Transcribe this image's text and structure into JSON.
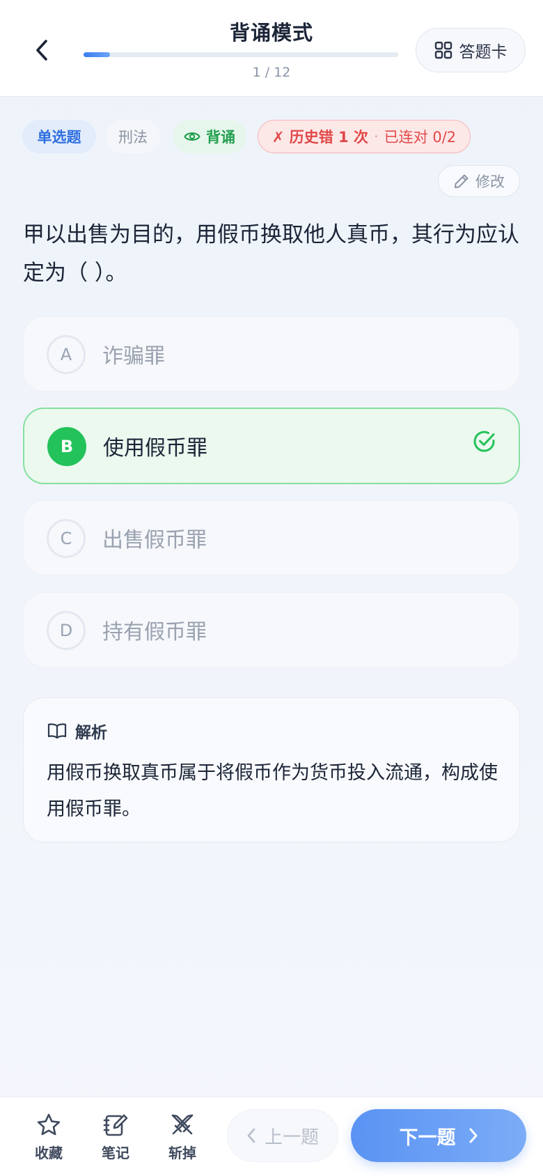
{
  "header": {
    "title": "背诵模式",
    "progress_text": "1 / 12",
    "progress_fraction": 0.083,
    "answer_card_label": "答题卡"
  },
  "tags": {
    "question_type": "单选题",
    "subject": "刑法",
    "mode": "背诵",
    "history_wrong": "✗ 历史错 1 次",
    "separator": "·",
    "streak": "已连对 0/2"
  },
  "edit_label": "修改",
  "question": "甲以出售为目的，用假币换取他人真币，其行为应认定为（ ）。",
  "options": [
    {
      "letter": "A",
      "text": "诈骗罪"
    },
    {
      "letter": "B",
      "text": "使用假币罪"
    },
    {
      "letter": "C",
      "text": "出售假币罪"
    },
    {
      "letter": "D",
      "text": "持有假币罪"
    }
  ],
  "selected_option": "B",
  "analysis": {
    "title": "解析",
    "body": "用假币换取真币属于将假币作为货币投入流通，构成使用假币罪。"
  },
  "bottom_bar": {
    "favorite": "收藏",
    "note": "笔记",
    "cut": "斩掉",
    "prev": "上一题",
    "next": "下一题"
  },
  "colors": {
    "accent_blue": "#3b7ef0",
    "correct_green": "#23c25a",
    "error_red": "#e24848"
  }
}
